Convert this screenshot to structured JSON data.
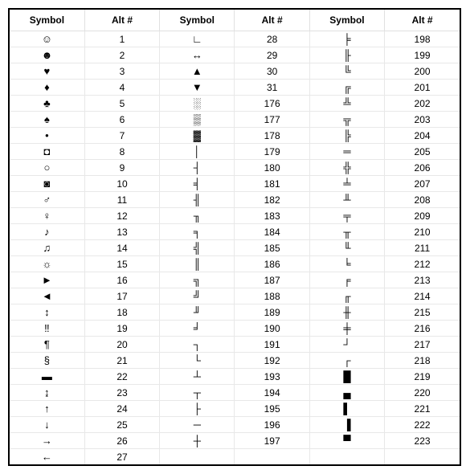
{
  "headers": [
    "Symbol",
    "Alt #",
    "Symbol",
    "Alt #",
    "Symbol",
    "Alt #"
  ],
  "rows": [
    {
      "s1": "☺",
      "a1": "1",
      "s2": "∟",
      "a2": "28",
      "s3": "╞",
      "a3": "198"
    },
    {
      "s1": "☻",
      "a1": "2",
      "s2": "↔",
      "a2": "29",
      "s3": "╟",
      "a3": "199"
    },
    {
      "s1": "♥",
      "a1": "3",
      "s2": "▲",
      "a2": "30",
      "s3": "╚",
      "a3": "200"
    },
    {
      "s1": "♦",
      "a1": "4",
      "s2": "▼",
      "a2": "31",
      "s3": "╔",
      "a3": "201"
    },
    {
      "s1": "♣",
      "a1": "5",
      "s2": "░",
      "a2": "176",
      "s3": "╩",
      "a3": "202"
    },
    {
      "s1": "♠",
      "a1": "6",
      "s2": "▒",
      "a2": "177",
      "s3": "╦",
      "a3": "203"
    },
    {
      "s1": "•",
      "a1": "7",
      "s2": "▓",
      "a2": "178",
      "s3": "╠",
      "a3": "204"
    },
    {
      "s1": "◘",
      "a1": "8",
      "s2": "│",
      "a2": "179",
      "s3": "═",
      "a3": "205"
    },
    {
      "s1": "○",
      "a1": "9",
      "s2": "┤",
      "a2": "180",
      "s3": "╬",
      "a3": "206"
    },
    {
      "s1": "◙",
      "a1": "10",
      "s2": "╡",
      "a2": "181",
      "s3": "╧",
      "a3": "207"
    },
    {
      "s1": "♂",
      "a1": "11",
      "s2": "╢",
      "a2": "182",
      "s3": "╨",
      "a3": "208"
    },
    {
      "s1": "♀",
      "a1": "12",
      "s2": "╖",
      "a2": "183",
      "s3": "╤",
      "a3": "209"
    },
    {
      "s1": "♪",
      "a1": "13",
      "s2": "╕",
      "a2": "184",
      "s3": "╥",
      "a3": "210"
    },
    {
      "s1": "♫",
      "a1": "14",
      "s2": "╣",
      "a2": "185",
      "s3": "╙",
      "a3": "211"
    },
    {
      "s1": "☼",
      "a1": "15",
      "s2": "║",
      "a2": "186",
      "s3": "╘",
      "a3": "212"
    },
    {
      "s1": "►",
      "a1": "16",
      "s2": "╗",
      "a2": "187",
      "s3": "╒",
      "a3": "213"
    },
    {
      "s1": "◄",
      "a1": "17",
      "s2": "╝",
      "a2": "188",
      "s3": "╓",
      "a3": "214"
    },
    {
      "s1": "↕",
      "a1": "18",
      "s2": "╜",
      "a2": "189",
      "s3": "╫",
      "a3": "215"
    },
    {
      "s1": "‼",
      "a1": "19",
      "s2": "╛",
      "a2": "190",
      "s3": "╪",
      "a3": "216"
    },
    {
      "s1": "¶",
      "a1": "20",
      "s2": "┐",
      "a2": "191",
      "s3": "┘",
      "a3": "217"
    },
    {
      "s1": "§",
      "a1": "21",
      "s2": "└",
      "a2": "192",
      "s3": "┌",
      "a3": "218"
    },
    {
      "s1": "▬",
      "a1": "22",
      "s2": "┴",
      "a2": "193",
      "s3": "█",
      "a3": "219"
    },
    {
      "s1": "↨",
      "a1": "23",
      "s2": "┬",
      "a2": "194",
      "s3": "▄",
      "a3": "220"
    },
    {
      "s1": "↑",
      "a1": "24",
      "s2": "├",
      "a2": "195",
      "s3": "▌",
      "a3": "221"
    },
    {
      "s1": "↓",
      "a1": "25",
      "s2": "─",
      "a2": "196",
      "s3": "▐",
      "a3": "222"
    },
    {
      "s1": "→",
      "a1": "26",
      "s2": "┼",
      "a2": "197",
      "s3": "▀",
      "a3": "223"
    },
    {
      "s1": "←",
      "a1": "27",
      "s2": "",
      "a2": "",
      "s3": "",
      "a3": ""
    }
  ]
}
